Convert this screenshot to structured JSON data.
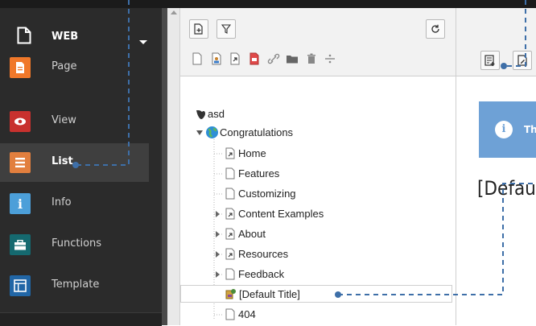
{
  "sidebar": {
    "header_label": "WEB",
    "modules": [
      {
        "label": "Page",
        "icon": "page-icon",
        "color": "#f0782a"
      },
      {
        "label": "View",
        "icon": "eye-icon",
        "color": "#c8312e"
      },
      {
        "label": "List",
        "icon": "list-icon",
        "color": "#e27f3e",
        "active": true
      },
      {
        "label": "Info",
        "icon": "info-icon",
        "color": "#4c9fd9"
      },
      {
        "label": "Functions",
        "icon": "briefcase-icon",
        "color": "#15696f"
      },
      {
        "label": "Template",
        "icon": "template-icon",
        "color": "#2166a6"
      }
    ]
  },
  "tree": {
    "root": "asd",
    "site": "Congratulations",
    "items": [
      "Home",
      "Features",
      "Customizing",
      "Content Examples",
      "About",
      "Resources",
      "Feedback",
      "[Default Title]",
      "404"
    ]
  },
  "content": {
    "info_text": "Th",
    "title": "[Defau"
  },
  "colors": {
    "annotation": "#3e6fa8",
    "sidebar_bg": "#2b2b2b",
    "info_box": "#6ea1d6"
  }
}
